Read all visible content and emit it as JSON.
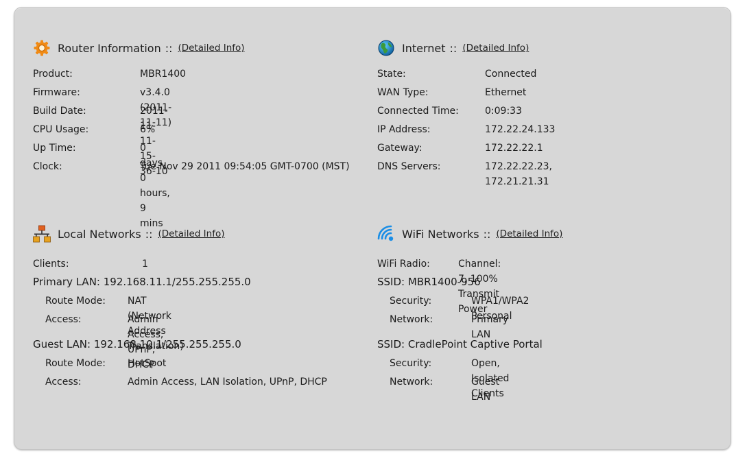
{
  "router": {
    "title": "Router Information",
    "separator": "::",
    "link": "(Detailed Info)",
    "rows": [
      {
        "label": "Product:",
        "value": "MBR1400"
      },
      {
        "label": "Firmware:",
        "value": "v3.4.0 (2011-11-11)"
      },
      {
        "label": "Build Date:",
        "value": "2011-11-11-15-36-10"
      },
      {
        "label": "CPU Usage:",
        "value": "6%"
      },
      {
        "label": "Up Time:",
        "value": "0 days, 0 hours, 9 mins"
      },
      {
        "label": "Clock:",
        "value": "Tue Nov 29 2011 09:54:05 GMT-0700 (MST)"
      }
    ]
  },
  "internet": {
    "title": "Internet",
    "separator": "::",
    "link": "(Detailed Info)",
    "rows": [
      {
        "label": "State:",
        "value": "Connected"
      },
      {
        "label": "WAN Type:",
        "value": "Ethernet"
      },
      {
        "label": "Connected Time:",
        "value": "0:09:33"
      },
      {
        "label": "IP Address:",
        "value": "172.22.24.133"
      },
      {
        "label": "Gateway:",
        "value": "172.22.22.1"
      },
      {
        "label": "DNS Servers:",
        "value": "172.22.22.23, 172.21.21.31"
      }
    ]
  },
  "local": {
    "title": "Local Networks",
    "separator": "::",
    "link": "(Detailed Info)",
    "clients": {
      "label": "Clients:",
      "value": "1"
    },
    "primary": {
      "header": "Primary LAN: 192.168.11.1/255.255.255.0",
      "route_label": "Route Mode:",
      "route_value": "NAT (Network Address Translation)",
      "access_label": "Access:",
      "access_value": "Admin Access, UPnP, DHCP"
    },
    "guest": {
      "header": "Guest LAN: 192.168.10.1/255.255.255.0",
      "route_label": "Route Mode:",
      "route_value": "HotSpot",
      "access_label": "Access:",
      "access_value": "Admin Access, LAN Isolation, UPnP, DHCP"
    }
  },
  "wifi": {
    "title": "WiFi Networks",
    "separator": "::",
    "link": "(Detailed Info)",
    "radio": {
      "label": "WiFi Radio:",
      "value": "Channel: 7, 100% Transmit Power"
    },
    "ssid1": {
      "header": "SSID: MBR1400-956",
      "security_label": "Security:",
      "security_value": "WPA1/WPA2 Personal",
      "network_label": "Network:",
      "network_value": "Primary LAN"
    },
    "ssid2": {
      "header": "SSID: CradlePoint Captive Portal",
      "security_label": "Security:",
      "security_value": "Open, Isolated Clients",
      "network_label": "Network:",
      "network_value": "Guest LAN"
    }
  },
  "icons": {
    "router": "gear-icon",
    "internet": "globe-icon",
    "local": "network-icon",
    "wifi": "wifi-icon"
  },
  "colors": {
    "panel_bg": "#d7d7d7",
    "gear": "#f08a14",
    "globe": "#2e8a3a",
    "network": "#e0611f",
    "wifi": "#1a8ee6"
  }
}
